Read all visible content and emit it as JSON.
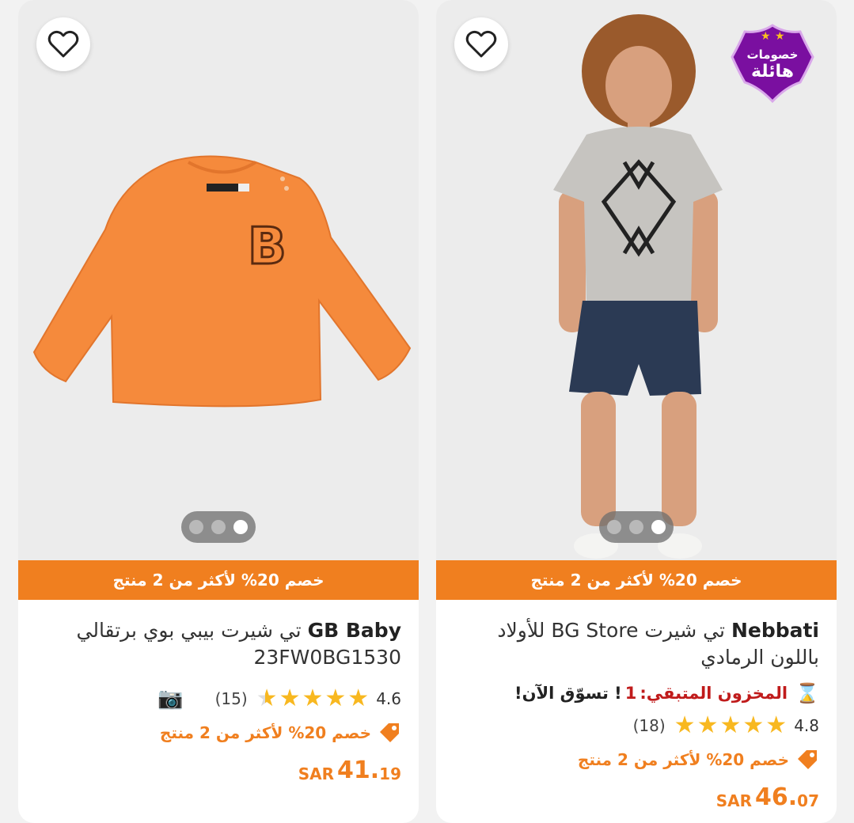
{
  "products": [
    {
      "brand": "GB Baby",
      "title": "تي شيرت بيبي بوي برتقالي",
      "sku": "23FW0BG1530",
      "promo_bar": "خصم 20% لأكثر من 2 منتج",
      "rating": "4.6",
      "rating_value": 4.6,
      "reviews": "(15)",
      "deal_text": "خصم 20% لأكثر من 2 منتج",
      "price_currency": "SAR",
      "price_int": "41.",
      "price_dec": "19",
      "carousel_active_index": 2,
      "carousel_count": 3,
      "product_image": "orange-long-sleeve-shirt",
      "review_media_icon": "camera-icon"
    },
    {
      "brand": "Nebbati",
      "title": "تي شيرت BG Store للأولاد باللون الرمادي",
      "promo_bar": "خصم 20% لأكثر من 2 منتج",
      "stock_label": "المخزون المتبقي: ",
      "stock_count": "1",
      "stock_cta": "! تسوّق الآن!",
      "rating": "4.8",
      "rating_value": 4.8,
      "reviews": "(18)",
      "deal_text": "خصم 20% لأكثر من 2 منتج",
      "price_currency": "SAR",
      "price_int": "46.",
      "price_dec": "07",
      "carousel_active_index": 2,
      "carousel_count": 3,
      "badge_line1": "خصومات",
      "badge_line2": "هائلة",
      "product_image": "boy-grey-tshirt-denim-shorts",
      "stock_icon": "hourglass-icon"
    }
  ],
  "colors": {
    "accent": "#f07f1f",
    "star": "#f8b820",
    "stock_red": "#c01b1b",
    "badge_purple": "#7a0fa0"
  }
}
